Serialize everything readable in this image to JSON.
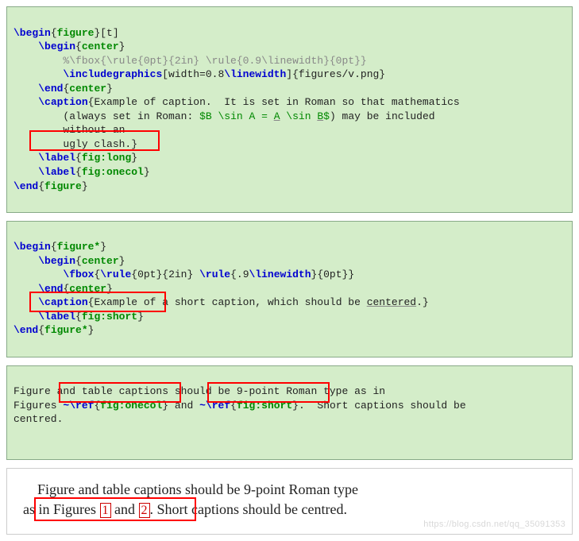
{
  "block1": {
    "l1a": "\\begin",
    "l1b": "figure",
    "l1c": "[t]",
    "l2a": "\\begin",
    "l2b": "center",
    "l3": "%\\fbox{\\rule{0pt}{2in} \\rule{0.9\\linewidth}{0pt}}",
    "l4a": "\\includegraphics",
    "l4b": "[width=0.8",
    "l4c": "\\linewidth",
    "l4d": "]{figures/v.png}",
    "l5a": "\\end",
    "l5b": "center",
    "l6a": "\\caption",
    "l6b": "{Example of caption.  It is set in Roman so that mathematics",
    "l7a": "(always set in Roman: ",
    "l7b": "$B \\sin A = ",
    "l7c": "A",
    "l7d": " \\sin ",
    "l7e": "B",
    "l7f": "$",
    "l7g": ") may be included",
    "l8": "without an",
    "l9": "ugly clash.}",
    "l10a": "\\label",
    "l10b": "fig:long",
    "l11a": "\\label",
    "l11b": "fig:onecol",
    "l12a": "\\end",
    "l12b": "figure"
  },
  "block2": {
    "l1a": "\\begin",
    "l1b": "figure*",
    "l2a": "\\begin",
    "l2b": "center",
    "l3a": "\\fbox",
    "l3b": "{",
    "l3c": "\\rule",
    "l3d": "{0pt}{2in} ",
    "l3e": "\\rule",
    "l3f": "{.9",
    "l3g": "\\linewidth",
    "l3h": "}{0pt}}",
    "l4a": "\\end",
    "l4b": "center",
    "l5a": "\\caption",
    "l5b": "{Example of a short caption, which should be ",
    "l5c": "centered",
    "l5d": ".}",
    "l6a": "\\label",
    "l6b": "fig:short",
    "l7a": "\\end",
    "l7b": "figure*"
  },
  "block3": {
    "l1": "Figure and table captions should be 9-point Roman type as in",
    "l2a": "Figures ",
    "l2b": "~",
    "l2c": "\\ref",
    "l2d": "fig:onecol",
    "l2e": " and ",
    "l2f": "~",
    "l2g": "\\ref",
    "l2h": "fig:short",
    "l2i": ".",
    "l2j": "  Short captions should be",
    "l3": "centred."
  },
  "output": {
    "indent": "    ",
    "t1": "Figure and table captions should be 9-point Roman type",
    "t2a": "as in Figures ",
    "r1": "1",
    "t2b": " and ",
    "r2": "2",
    "t2c": ". Short captions should be centred.",
    "watermark": "https://blog.csdn.net/qq_35091353"
  }
}
